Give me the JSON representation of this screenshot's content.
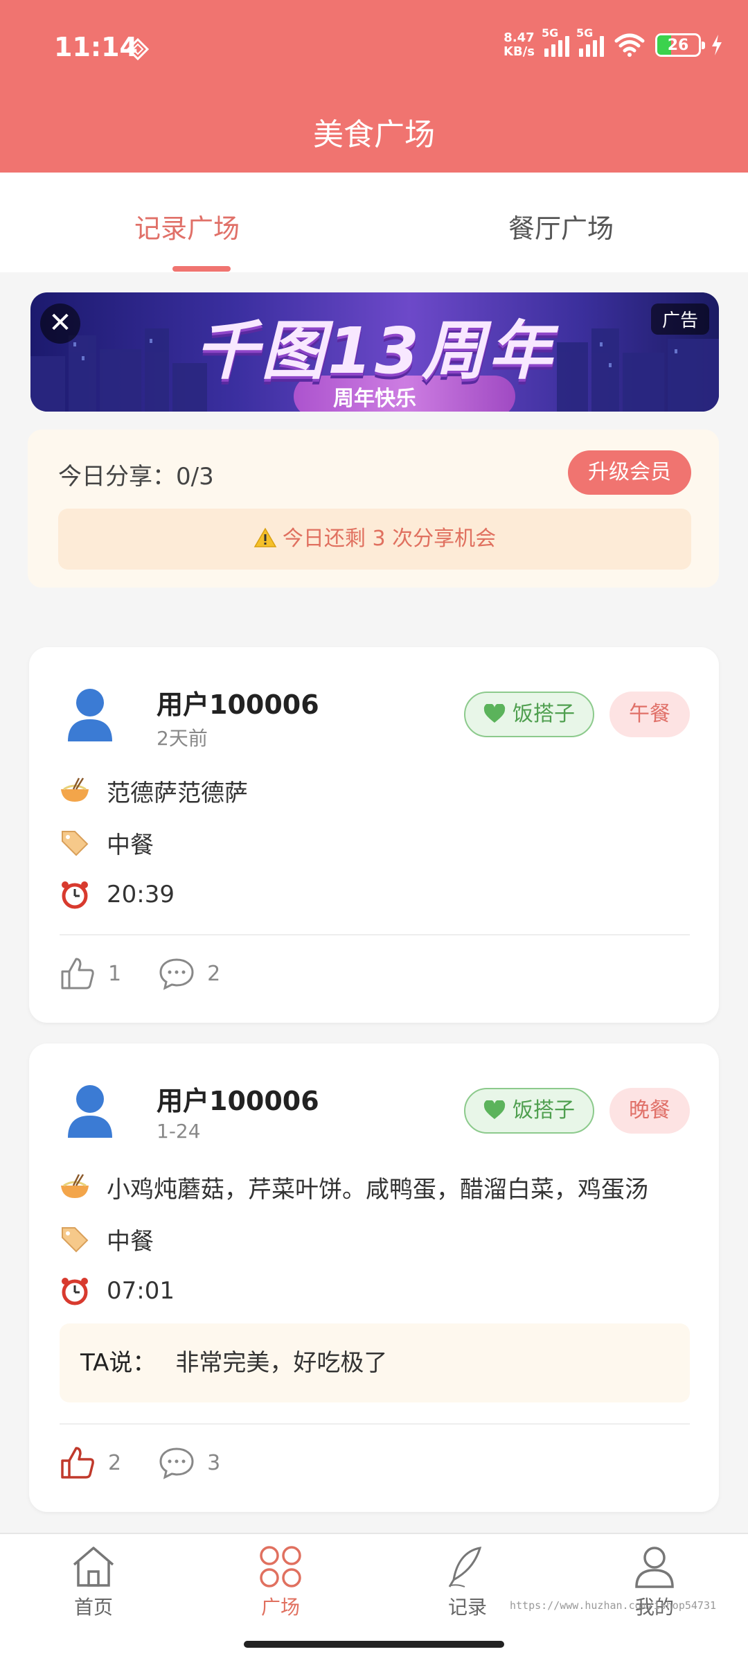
{
  "status_bar": {
    "time": "11:14",
    "net_speed_value": "8.47",
    "net_speed_unit": "KB/s",
    "signal1_label": "5G",
    "signal2_label": "5G",
    "battery": "26"
  },
  "header": {
    "title": "美食广场"
  },
  "tabs": [
    {
      "label": "记录广场",
      "active": true
    },
    {
      "label": "餐厅广场",
      "active": false
    }
  ],
  "ad": {
    "headline": "千图13周年",
    "subline": "周年快乐",
    "label": "广告",
    "close_glyph": "✕"
  },
  "share": {
    "today_label": "今日分享：0/3",
    "upgrade_label": "升级会员",
    "notice": "今日还剩 3 次分享机会"
  },
  "posts": [
    {
      "username": "用户100006",
      "time": "2天前",
      "buddy_tag": "饭搭子",
      "meal_tag": "午餐",
      "dish": "范德萨范德萨",
      "category": "中餐",
      "clock": "20:39",
      "likes": "1",
      "comments": "2",
      "liked": false
    },
    {
      "username": "用户100006",
      "time": "1-24",
      "buddy_tag": "饭搭子",
      "meal_tag": "晚餐",
      "dish": "小鸡炖蘑菇，芹菜叶饼。咸鸭蛋，醋溜白菜，鸡蛋汤",
      "category": "中餐",
      "clock": "07:01",
      "comment_label": "TA说：",
      "comment_text": "非常完美，好吃极了",
      "likes": "2",
      "comments": "3",
      "liked": true
    }
  ],
  "bottom_nav": [
    {
      "label": "首页",
      "icon": "home-icon",
      "active": false
    },
    {
      "label": "广场",
      "icon": "grid-icon",
      "active": true
    },
    {
      "label": "记录",
      "icon": "feather-pen-icon",
      "active": false
    },
    {
      "label": "我的",
      "icon": "user-icon",
      "active": false
    }
  ],
  "watermark": "https://www.huzhan.com/ishop54731",
  "colors": {
    "brand": "#f07470",
    "accent_text": "#e0705f",
    "buddy_green": "#4f9f4f",
    "background": "#f5f5f5"
  }
}
